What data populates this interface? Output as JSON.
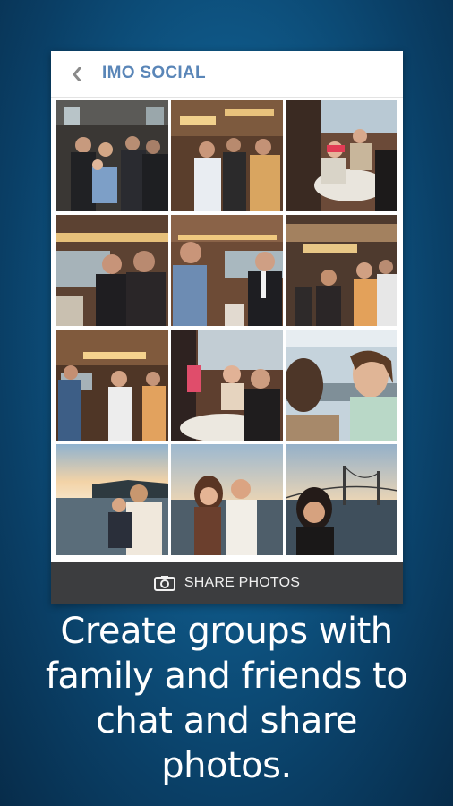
{
  "appbar": {
    "title": "IMO SOCIAL",
    "back_icon": "chevron-left-icon"
  },
  "photos": [
    {
      "scene": "crowd-indoor"
    },
    {
      "scene": "party-chandelier"
    },
    {
      "scene": "dining-window"
    },
    {
      "scene": "two-men-talking"
    },
    {
      "scene": "man-portrait-indoor"
    },
    {
      "scene": "crowd-chandelier"
    },
    {
      "scene": "group-chandelier"
    },
    {
      "scene": "table-women"
    },
    {
      "scene": "man-profile"
    },
    {
      "scene": "sunset-family"
    },
    {
      "scene": "sunset-couple"
    },
    {
      "scene": "sunset-bridge-woman"
    }
  ],
  "share": {
    "label": "SHARE PHOTOS",
    "icon": "camera-icon"
  },
  "caption": {
    "line1": "Create groups with",
    "line2": "family and friends to",
    "line3": "chat and share",
    "line4": "photos."
  },
  "colors": {
    "title": "#5a86b8",
    "share_bar": "#3c3d3f",
    "background": "#0f5a8a"
  }
}
